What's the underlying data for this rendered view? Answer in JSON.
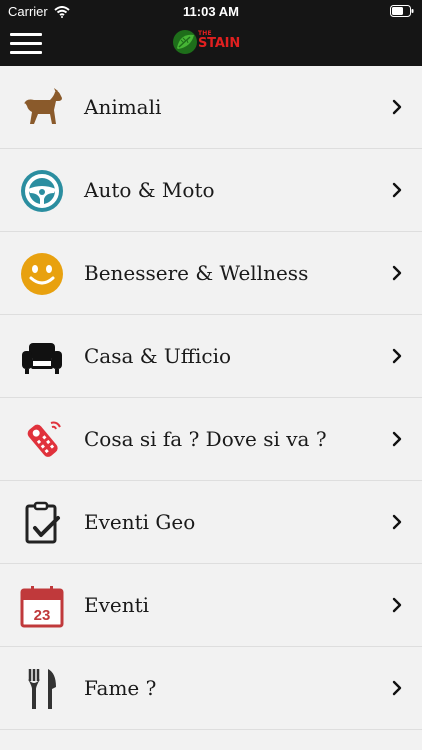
{
  "status_bar": {
    "carrier": "Carrier",
    "time": "11:03 AM"
  },
  "header": {
    "logo_small": "THE",
    "logo_text": "STAIN"
  },
  "colors": {
    "header_bg": "#151515",
    "logo_red": "#e02020",
    "logo_green": "#46b535",
    "list_bg": "#f2f2f2"
  },
  "categories": [
    {
      "label": "Animali",
      "icon": "dog-icon"
    },
    {
      "label": "Auto & Moto",
      "icon": "steering-wheel-icon"
    },
    {
      "label": "Benessere & Wellness",
      "icon": "smiley-icon"
    },
    {
      "label": "Casa & Ufficio",
      "icon": "armchair-icon"
    },
    {
      "label": "Cosa si fa ? Dove si va ?",
      "icon": "remote-control-icon"
    },
    {
      "label": "Eventi Geo",
      "icon": "clipboard-check-icon"
    },
    {
      "label": "Eventi",
      "icon": "calendar-icon",
      "icon_text": "23"
    },
    {
      "label": "Fame ?",
      "icon": "fork-knife-icon"
    }
  ]
}
